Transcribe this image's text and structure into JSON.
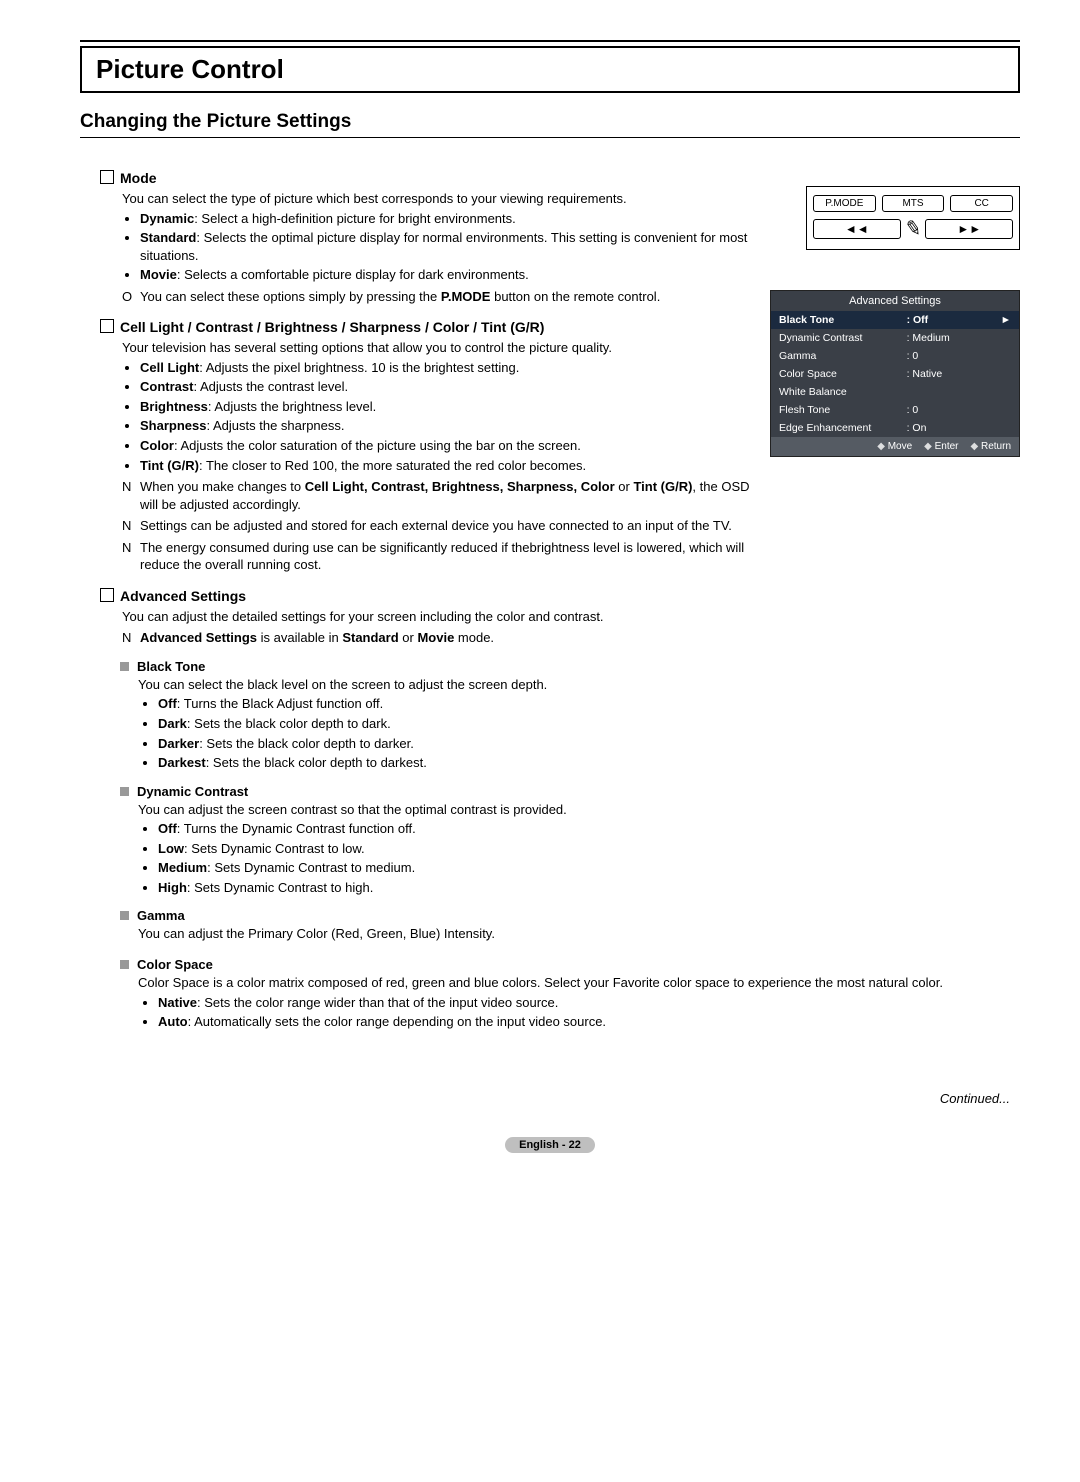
{
  "header": {
    "title": "Picture Control",
    "section": "Changing the Picture Settings"
  },
  "mode": {
    "heading": "Mode",
    "desc": "You can select the type of picture which best corresponds to your viewing requirements.",
    "items": [
      {
        "term": "Dynamic",
        "text": ": Select a high-definition picture for bright environments."
      },
      {
        "term": "Standard",
        "text": ": Selects the optimal picture display for normal environments. This setting is convenient for most situations."
      },
      {
        "term": "Movie",
        "text": ": Selects a comfortable picture display for dark environments."
      }
    ],
    "note_mark": "O",
    "note_pre": "You can select these options simply by pressing the ",
    "note_btn": "P.MODE",
    "note_post": " button on the remote control."
  },
  "cell": {
    "heading": "Cell Light / Contrast / Brightness / Sharpness / Color / Tint (G/R)",
    "desc": "Your television has several setting options that allow you to control the picture quality.",
    "items": [
      {
        "term": "Cell Light",
        "text": ": Adjusts the pixel brightness. 10 is the brightest setting."
      },
      {
        "term": "Contrast",
        "text": ": Adjusts the contrast level."
      },
      {
        "term": "Brightness",
        "text": ": Adjusts the brightness level."
      },
      {
        "term": "Sharpness",
        "text": ": Adjusts the sharpness."
      },
      {
        "term": "Color",
        "text": ": Adjusts the color saturation of the picture using the bar on the screen."
      },
      {
        "term": "Tint (G/R)",
        "text": ": The closer to Red 100, the more saturated the red color becomes."
      }
    ],
    "notes_mark": "N",
    "note1_pre": "When you make changes to ",
    "note1_terms": "Cell Light, Contrast, Brightness, Sharpness, Color",
    "note1_mid": " or ",
    "note1_term_last": "Tint (G/R)",
    "note1_post": ", the OSD will be adjusted accordingly.",
    "note2": "Settings can be adjusted and stored for each external device you have connected to an input of the TV.",
    "note3": "The energy consumed during use can be significantly reduced if thebrightness level is lowered, which will reduce the overall running cost."
  },
  "adv": {
    "heading": "Advanced Settings",
    "desc": "You can adjust the detailed settings for your screen including the color and contrast.",
    "note_mark": "N",
    "note_bold": "Advanced Settings",
    "note_mid": " is available in ",
    "note_b1": "Standard",
    "note_or": " or ",
    "note_b2": "Movie",
    "note_post": " mode.",
    "black": {
      "title": "Black Tone",
      "desc": "You can select the black level on the screen to adjust the screen depth.",
      "items": [
        {
          "term": "Off",
          "text": ": Turns the Black Adjust function off."
        },
        {
          "term": "Dark",
          "text": ": Sets the black color depth to dark."
        },
        {
          "term": "Darker",
          "text": ": Sets the black color depth to darker."
        },
        {
          "term": "Darkest",
          "text": ": Sets the black color depth to darkest."
        }
      ]
    },
    "dyn": {
      "title": "Dynamic Contrast",
      "desc": "You can adjust the screen contrast so that the optimal contrast is provided.",
      "items": [
        {
          "term": "Off",
          "text": ": Turns the Dynamic Contrast function off."
        },
        {
          "term": "Low",
          "text": ": Sets Dynamic Contrast to low."
        },
        {
          "term": "Medium",
          "text": ": Sets Dynamic Contrast to medium."
        },
        {
          "term": "High",
          "text": ": Sets Dynamic Contrast to high."
        }
      ]
    },
    "gamma": {
      "title": "Gamma",
      "desc": "You can adjust the Primary Color (Red, Green, Blue) Intensity."
    },
    "cspace": {
      "title": "Color Space",
      "desc": "Color Space is a color matrix composed of red, green and blue colors. Select your Favorite color space to experience the most natural color.",
      "items": [
        {
          "term": "Native",
          "text": ": Sets the color range wider than that of the input video source."
        },
        {
          "term": "Auto",
          "text": ": Automatically sets the color range depending on the input video source."
        }
      ]
    }
  },
  "remote": {
    "btn1": "P.MODE",
    "btn2": "MTS",
    "btn3": "CC",
    "rew": "◄◄",
    "ff": "►►"
  },
  "osd": {
    "title": "Advanced Settings",
    "rows": [
      {
        "label": "Black Tone",
        "val": ": Off",
        "hl": true,
        "arr": "►"
      },
      {
        "label": "Dynamic Contrast",
        "val": ": Medium"
      },
      {
        "label": "Gamma",
        "val": ": 0"
      },
      {
        "label": "Color Space",
        "val": ": Native"
      },
      {
        "label": "White Balance",
        "val": ""
      },
      {
        "label": "Flesh Tone",
        "val": ": 0"
      },
      {
        "label": "Edge Enhancement",
        "val": ": On"
      }
    ],
    "foot": {
      "move": "Move",
      "enter": "Enter",
      "return": "Return"
    }
  },
  "footer": {
    "continued": "Continued...",
    "page": "English - 22"
  }
}
